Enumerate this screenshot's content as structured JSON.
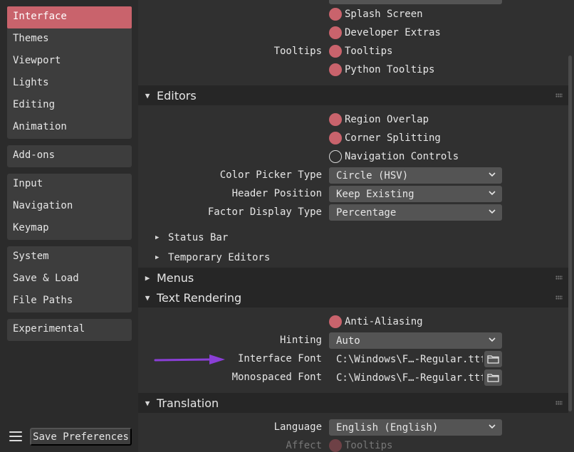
{
  "sidebar": {
    "group1": [
      "Interface",
      "Themes",
      "Viewport",
      "Lights",
      "Editing",
      "Animation"
    ],
    "group2": [
      "Add-ons"
    ],
    "group3": [
      "Input",
      "Navigation",
      "Keymap"
    ],
    "group4": [
      "System",
      "Save & Load",
      "File Paths"
    ],
    "group5": [
      "Experimental"
    ],
    "active": "Interface",
    "save_label": "Save Preferences",
    "menu_icon": "hamburger-icon"
  },
  "display_section": {
    "splash_screen": "Splash Screen",
    "developer_extras": "Developer Extras",
    "tooltips_label": "Tooltips",
    "tooltips": "Tooltips",
    "python_tooltips": "Python Tooltips"
  },
  "editors": {
    "header": "Editors",
    "region_overlap": "Region Overlap",
    "corner_splitting": "Corner Splitting",
    "navigation_controls": "Navigation Controls",
    "color_picker_label": "Color Picker Type",
    "color_picker_value": "Circle (HSV)",
    "header_position_label": "Header Position",
    "header_position_value": "Keep Existing",
    "factor_display_label": "Factor Display Type",
    "factor_display_value": "Percentage",
    "status_bar": "Status Bar",
    "temporary_editors": "Temporary Editors"
  },
  "menus": {
    "header": "Menus"
  },
  "text_rendering": {
    "header": "Text Rendering",
    "anti_aliasing": "Anti-Aliasing",
    "hinting_label": "Hinting",
    "hinting_value": "Auto",
    "interface_font_label": "Interface Font",
    "interface_font_value": "C:\\Windows\\F…-Regular.ttf",
    "mono_font_label": "Monospaced Font",
    "mono_font_value": "C:\\Windows\\F…-Regular.ttf"
  },
  "translation": {
    "header": "Translation",
    "language_label": "Language",
    "language_value": "English (English)",
    "affect_label": "Affect",
    "affect_tooltips": "Tooltips"
  },
  "colors": {
    "accent": "#c9636c",
    "annotation_arrow": "#8a3fd6"
  }
}
